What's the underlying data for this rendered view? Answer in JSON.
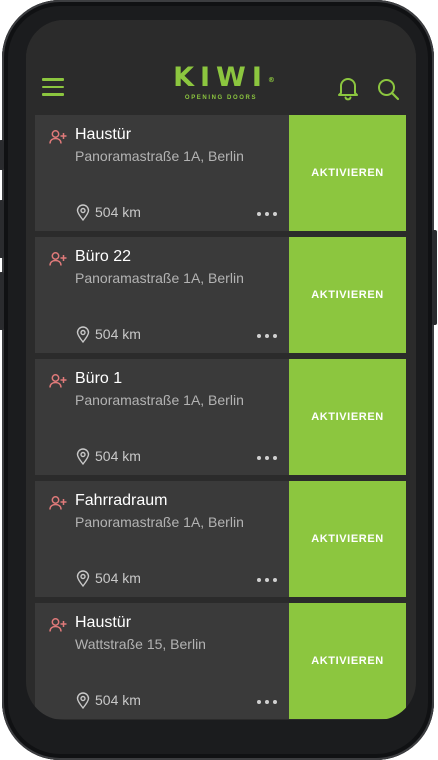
{
  "header": {
    "logo_text": "KIWI",
    "logo_trademark": "®",
    "tagline": "OPENING DOORS",
    "menu_icon": "hamburger-menu-icon",
    "notification_icon": "bell-icon",
    "search_icon": "search-icon"
  },
  "theme": {
    "accent": "#8cc63f",
    "card_background": "#3a3a3a",
    "screen_background": "#2b2b2b",
    "user_icon_color": "#e07a7a"
  },
  "doors": [
    {
      "name": "Haustür",
      "address": "Panoramastraße 1A, Berlin",
      "distance": "504 km",
      "action": "AKTIVIEREN"
    },
    {
      "name": "Büro 22",
      "address": "Panoramastraße 1A, Berlin",
      "distance": "504 km",
      "action": "AKTIVIEREN"
    },
    {
      "name": "Büro 1",
      "address": "Panoramastraße 1A, Berlin",
      "distance": "504 km",
      "action": "AKTIVIEREN"
    },
    {
      "name": "Fahrradraum",
      "address": "Panoramastraße 1A, Berlin",
      "distance": "504 km",
      "action": "AKTIVIEREN"
    },
    {
      "name": "Haustür",
      "address": "Wattstraße 15, Berlin",
      "distance": "504 km",
      "action": "AKTIVIEREN"
    }
  ]
}
